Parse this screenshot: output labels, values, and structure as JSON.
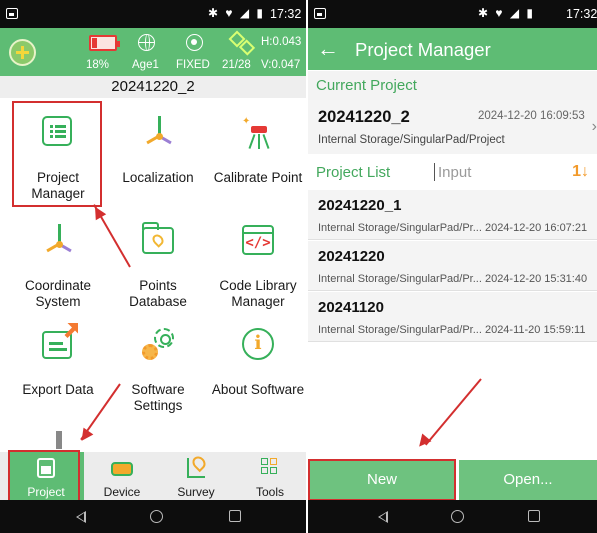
{
  "left": {
    "status_bar": {
      "time": "17:32",
      "icons": "bluetooth-icon wifi-icon signal-icon battery-icon"
    },
    "info": {
      "battery_pct": "18%",
      "age": "Age1",
      "fix": "FIXED",
      "sats": "21/28",
      "h_precision": "H:0.043",
      "v_precision": "V:0.047",
      "battery_level": 0.18
    },
    "project_name": "20241220_2",
    "tiles": [
      {
        "label": "Project\nManager",
        "icon": "document-list-icon"
      },
      {
        "label": "Localization",
        "icon": "axes-icon"
      },
      {
        "label": "Calibrate Point",
        "icon": "tripod-icon"
      },
      {
        "label": "Coordinate\nSystem",
        "icon": "coordinate-axes-icon"
      },
      {
        "label": "Points\nDatabase",
        "icon": "folder-pin-icon"
      },
      {
        "label": "Code Library\nManager",
        "icon": "code-icon"
      },
      {
        "label": "Export Data",
        "icon": "export-icon"
      },
      {
        "label": "Software\nSettings",
        "icon": "gear-icon"
      },
      {
        "label": "About Software",
        "icon": "info-icon"
      }
    ],
    "tabs": [
      {
        "label": "Project",
        "icon": "project-icon",
        "active": true
      },
      {
        "label": "Device",
        "icon": "device-icon",
        "active": false
      },
      {
        "label": "Survey",
        "icon": "survey-icon",
        "active": false
      },
      {
        "label": "Tools",
        "icon": "tools-icon",
        "active": false
      }
    ]
  },
  "right": {
    "status_bar": {
      "time": "17:32"
    },
    "header": {
      "back_icon": "←",
      "title": "Project Manager"
    },
    "current_section": "Current Project",
    "current": {
      "name": "20241220_2",
      "date": "2024-12-20 16:09:53",
      "path": "Internal Storage/SingularPad/Project"
    },
    "list_section": "Project List",
    "search_placeholder": "Input",
    "sort_icon": "1↓",
    "projects": [
      {
        "name": "20241220_1",
        "path": "Internal Storage/SingularPad/Pr...",
        "date": "2024-12-20 16:07:21"
      },
      {
        "name": "20241220",
        "path": "Internal Storage/SingularPad/Pr...",
        "date": "2024-12-20 15:31:40"
      },
      {
        "name": "20241120",
        "path": "Internal Storage/SingularPad/Pr...",
        "date": "2024-11-20 15:59:11"
      }
    ],
    "buttons": {
      "new": "New",
      "open": "Open..."
    }
  },
  "colors": {
    "accent": "#5ebc74",
    "highlight": "#d32f2f",
    "section_text": "#43a85d"
  }
}
